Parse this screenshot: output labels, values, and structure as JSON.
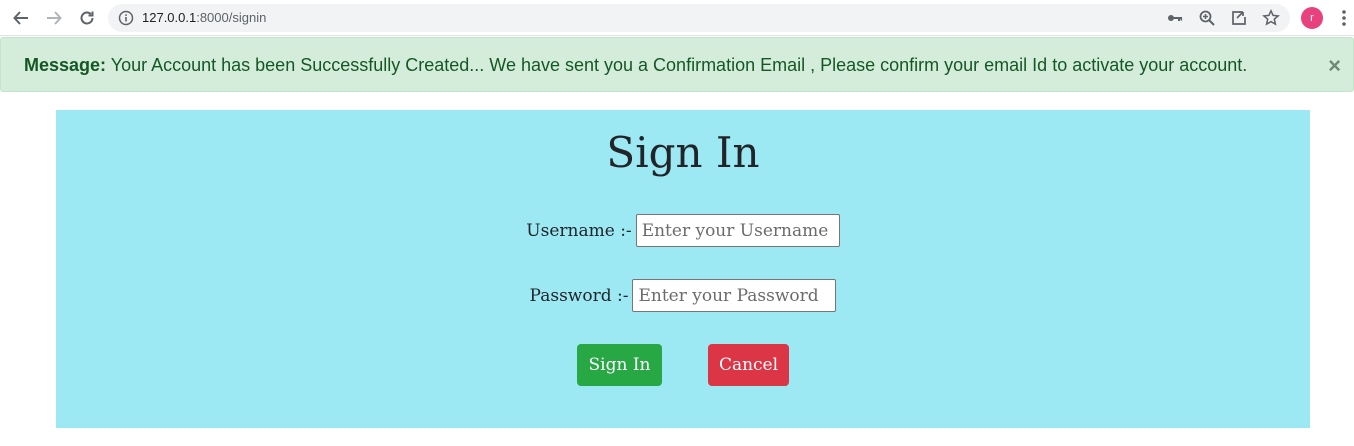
{
  "browser": {
    "url_host": "127.0.0.1",
    "url_path": ":8000/signin",
    "profile_initial": "r"
  },
  "alert": {
    "label": "Message:",
    "text": " Your Account has been Successfully Created... We have sent you a Confirmation Email , Please confirm your email Id to activate your account.",
    "close": "×"
  },
  "form": {
    "title": "Sign In",
    "username_label": "Username :-",
    "username_placeholder": "Enter your Username",
    "password_label": "Password :-",
    "password_placeholder": "Enter your Password",
    "signin_button": "Sign In",
    "cancel_button": "Cancel"
  },
  "colors": {
    "panel_bg": "#9ce9f4",
    "alert_bg": "#d4eddb",
    "alert_text": "#155724",
    "signin_btn": "#28a745",
    "cancel_btn": "#dc3545",
    "profile": "#e8417d"
  },
  "icons": [
    "back-arrow-icon",
    "forward-arrow-icon",
    "reload-icon",
    "info-icon",
    "key-icon",
    "zoom-icon",
    "share-icon",
    "star-icon",
    "menu-dots-icon"
  ]
}
